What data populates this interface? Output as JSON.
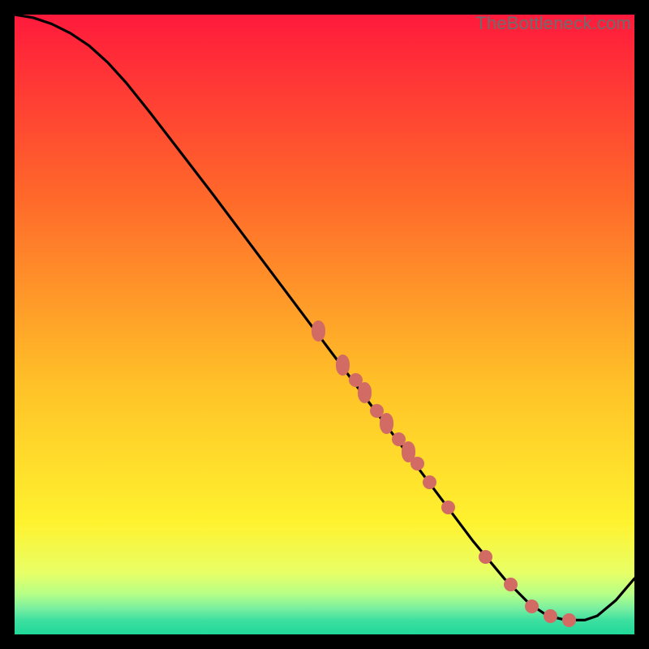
{
  "watermark": "TheBottleneck.com",
  "chart_data": {
    "type": "line",
    "title": "",
    "xlabel": "",
    "ylabel": "",
    "xlim": [
      0,
      100
    ],
    "ylim": [
      0,
      100
    ],
    "grid": false,
    "legend": false,
    "curve": [
      {
        "x": 0.0,
        "y": 100.0
      },
      {
        "x": 3.0,
        "y": 99.5
      },
      {
        "x": 6.0,
        "y": 98.5
      },
      {
        "x": 9.0,
        "y": 97.0
      },
      {
        "x": 12.0,
        "y": 95.0
      },
      {
        "x": 15.0,
        "y": 92.3
      },
      {
        "x": 18.0,
        "y": 89.0
      },
      {
        "x": 22.0,
        "y": 84.0
      },
      {
        "x": 27.0,
        "y": 77.5
      },
      {
        "x": 32.0,
        "y": 71.0
      },
      {
        "x": 38.0,
        "y": 63.0
      },
      {
        "x": 44.0,
        "y": 55.0
      },
      {
        "x": 50.0,
        "y": 47.0
      },
      {
        "x": 56.0,
        "y": 39.0
      },
      {
        "x": 62.0,
        "y": 31.0
      },
      {
        "x": 68.0,
        "y": 23.0
      },
      {
        "x": 74.0,
        "y": 15.0
      },
      {
        "x": 79.0,
        "y": 9.0
      },
      {
        "x": 83.0,
        "y": 5.0
      },
      {
        "x": 86.0,
        "y": 3.0
      },
      {
        "x": 89.0,
        "y": 2.3
      },
      {
        "x": 92.0,
        "y": 2.3
      },
      {
        "x": 94.0,
        "y": 3.0
      },
      {
        "x": 97.0,
        "y": 5.5
      },
      {
        "x": 100.0,
        "y": 9.0
      }
    ],
    "highlight_points": [
      {
        "x": 49.0,
        "y": 49.0,
        "elongated": true
      },
      {
        "x": 53.0,
        "y": 43.5,
        "elongated": true
      },
      {
        "x": 55.0,
        "y": 41.0,
        "elongated": false
      },
      {
        "x": 56.5,
        "y": 39.0,
        "elongated": true
      },
      {
        "x": 58.5,
        "y": 36.0,
        "elongated": false
      },
      {
        "x": 60.0,
        "y": 34.0,
        "elongated": true
      },
      {
        "x": 62.0,
        "y": 31.5,
        "elongated": false
      },
      {
        "x": 63.5,
        "y": 29.5,
        "elongated": true
      },
      {
        "x": 65.0,
        "y": 27.5,
        "elongated": false
      },
      {
        "x": 67.0,
        "y": 24.5,
        "elongated": false
      },
      {
        "x": 70.0,
        "y": 20.5,
        "elongated": false
      },
      {
        "x": 76.0,
        "y": 12.5,
        "elongated": false
      },
      {
        "x": 80.0,
        "y": 8.0,
        "elongated": false
      },
      {
        "x": 83.5,
        "y": 4.5,
        "elongated": false
      },
      {
        "x": 86.5,
        "y": 3.0,
        "elongated": false
      },
      {
        "x": 89.5,
        "y": 2.3,
        "elongated": false
      }
    ],
    "gradient_bands": [
      {
        "y_top": 100,
        "y_bot": 70,
        "color_top": "#ff1a3c",
        "color_bot": "#ff6a2a"
      },
      {
        "y_top": 70,
        "y_bot": 40,
        "color_top": "#ff6a2a",
        "color_bot": "#ffc228"
      },
      {
        "y_top": 40,
        "y_bot": 18,
        "color_top": "#ffc228",
        "color_bot": "#fff22e"
      },
      {
        "y_top": 18,
        "y_bot": 10,
        "color_top": "#fff22e",
        "color_bot": "#e8ff66"
      },
      {
        "y_top": 10,
        "y_bot": 6.5,
        "color_top": "#e8ff66",
        "color_bot": "#b6ff86"
      },
      {
        "y_top": 6.5,
        "y_bot": 4.2,
        "color_top": "#b6ff86",
        "color_bot": "#7aefa0"
      },
      {
        "y_top": 4.2,
        "y_bot": 2.4,
        "color_top": "#7aefa0",
        "color_bot": "#3fe0a0"
      },
      {
        "y_top": 2.4,
        "y_bot": 0.0,
        "color_top": "#3fe0a0",
        "color_bot": "#1fd89a"
      }
    ]
  }
}
